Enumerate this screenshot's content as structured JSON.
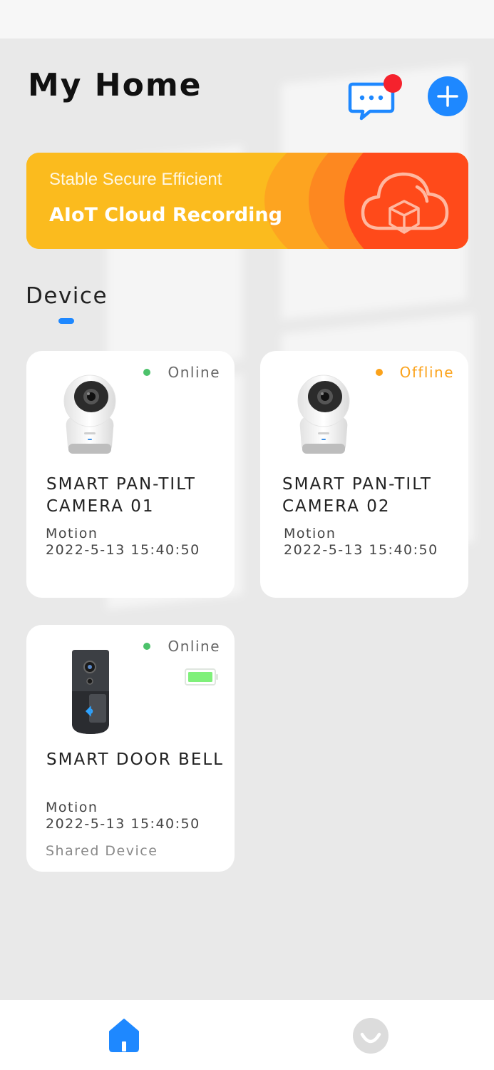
{
  "header": {
    "title": "My Home",
    "message_icon": "chat-bubble-icon",
    "add_icon": "plus-icon"
  },
  "banner": {
    "subtitle": "Stable Secure Efficient",
    "title": "AIoT Cloud Recording",
    "icon": "cloud-box-icon"
  },
  "section": {
    "title": "Device"
  },
  "devices": [
    {
      "name": "SMART PAN-TILT CAMERA 01",
      "status": "Online",
      "event": "Motion",
      "time": "2022-5-13 15:40:50",
      "image": "pan-tilt-camera-image"
    },
    {
      "name": "SMART PAN-TILT CAMERA 02",
      "status": "Offline",
      "event": "Motion",
      "time": "2022-5-13 15:40:50",
      "image": "pan-tilt-camera-image"
    },
    {
      "name": "SMART DOOR BELL",
      "status": "Online",
      "event": "Motion",
      "time": "2022-5-13 15:40:50",
      "note": "Shared Device",
      "image": "doorbell-image",
      "battery_icon": "battery-full-icon"
    }
  ],
  "bottom_nav": {
    "items": [
      {
        "icon": "home-icon",
        "active": true
      },
      {
        "icon": "profile-smile-icon",
        "active": false
      }
    ]
  },
  "colors": {
    "accent": "#1e88ff",
    "online": "#4cc26b",
    "offline": "#fba21a",
    "badge": "#f5222d",
    "banner_yellow": "#fbbb1e",
    "banner_red": "#ff4a1a"
  }
}
